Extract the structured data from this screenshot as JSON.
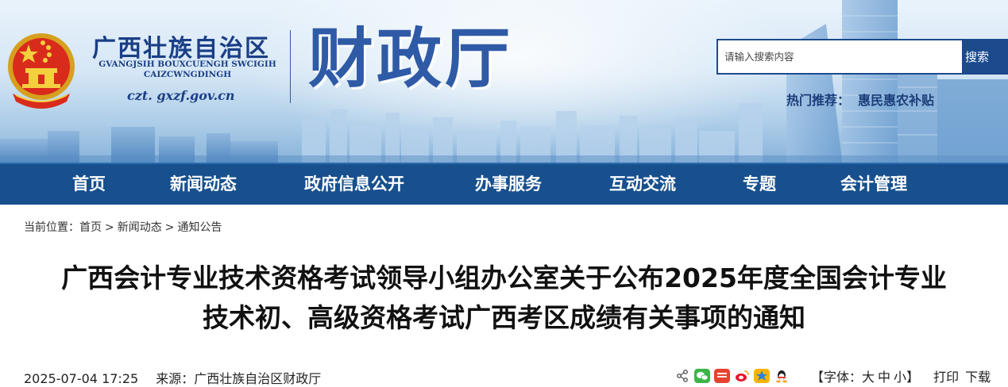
{
  "header": {
    "site_name": "广西壮族自治区",
    "site_pinyin": "GVANGJSIH BOUXCUENGH SWCIGIH CAIZCWNGDINGH",
    "domain": "czt. gxzf.gov.cn",
    "dept_name": "财政厅",
    "search": {
      "placeholder": "请输入搜索内容",
      "button": "搜索"
    },
    "hot_label": "热门推荐：",
    "hot_link": "惠民惠农补贴"
  },
  "nav": {
    "items": [
      "首页",
      "新闻动态",
      "政府信息公开",
      "办事服务",
      "互动交流",
      "专题",
      "会计管理"
    ]
  },
  "breadcrumb": {
    "label": "当前位置：",
    "items": [
      "首页",
      "新闻动态",
      "通知公告"
    ],
    "separator": ">"
  },
  "article": {
    "title_line1": "广西会计专业技术资格考试领导小组办公室关于公布2025年度全国会计专业",
    "title_line2": "技术初、高级资格考试广西考区成绩有关事项的通知",
    "datetime": "2025-07-04 17:25",
    "source": "来源：广西壮族自治区财政厅"
  },
  "tools": {
    "share_icons": [
      "share-icon",
      "wechat-icon",
      "toutiao-icon",
      "weibo-icon",
      "qzone-icon",
      "qq-icon"
    ],
    "font_open": "【字体：",
    "font_large": "大",
    "font_medium": "中",
    "font_small": "小",
    "font_close": "】",
    "print": "打印",
    "download": "下载"
  },
  "colors": {
    "nav_bg": "#17508d",
    "brand_blue": "#1c4a8d",
    "dept_blue": "#2f5aa6"
  }
}
